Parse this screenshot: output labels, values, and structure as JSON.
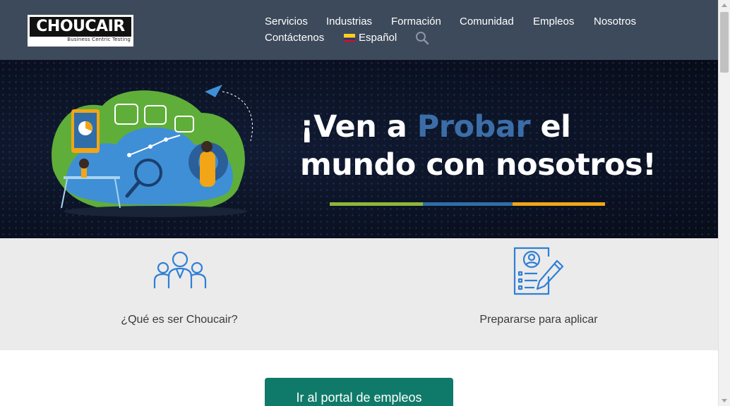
{
  "brand": {
    "name": "CHOUCAIR",
    "tagline": "Business Centric Testing"
  },
  "nav": {
    "items": [
      "Servicios",
      "Industrias",
      "Formación",
      "Comunidad",
      "Empleos",
      "Nosotros",
      "Contáctenos"
    ],
    "language": "Español",
    "language_flag": "colombia-flag"
  },
  "hero": {
    "line1_pre": "¡Ven a ",
    "line1_accent": "Probar",
    "line1_post": " el",
    "line2": "mundo con nosotros!",
    "accent_color": "#3b6ea8",
    "bar_colors": [
      "#8fb63a",
      "#2f6ea8",
      "#f2a516"
    ]
  },
  "features": [
    {
      "label": "¿Qué es ser Choucair?",
      "icon": "team-icon"
    },
    {
      "label": "Prepararse para aplicar",
      "icon": "resume-pencil-icon"
    }
  ],
  "cta": {
    "label": "Ir al portal de empleos",
    "color": "#107a6a"
  },
  "colors": {
    "header_bg": "#3d4a5b",
    "icon_blue": "#2f7fd6"
  }
}
